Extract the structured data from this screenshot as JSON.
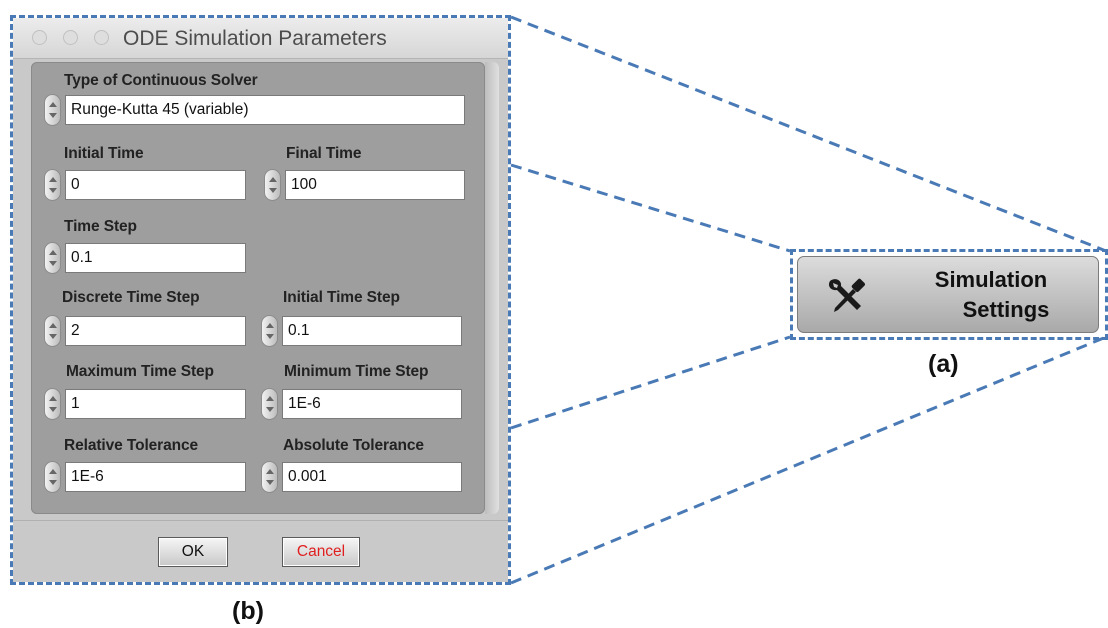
{
  "dialog": {
    "title": "ODE Simulation Parameters",
    "solver": {
      "label": "Type of Continuous Solver",
      "value": "Runge-Kutta 45 (variable)"
    },
    "fields": {
      "initial_time": {
        "label": "Initial Time",
        "value": "0"
      },
      "final_time": {
        "label": "Final Time",
        "value": "100"
      },
      "time_step": {
        "label": "Time Step",
        "value": "0.1"
      },
      "discrete_time_step": {
        "label": "Discrete Time Step",
        "value": "2"
      },
      "initial_time_step": {
        "label": "Initial Time Step",
        "value": "0.1"
      },
      "maximum_time_step": {
        "label": "Maximum Time Step",
        "value": "1"
      },
      "minimum_time_step": {
        "label": "Minimum Time Step",
        "value": "1E-6"
      },
      "relative_tolerance": {
        "label": "Relative Tolerance",
        "value": "1E-6"
      },
      "absolute_tolerance": {
        "label": "Absolute Tolerance",
        "value": "0.001"
      }
    },
    "buttons": {
      "ok": "OK",
      "cancel": "Cancel"
    }
  },
  "simulation_button": {
    "line1": "Simulation",
    "line2": "Settings",
    "icon": "tools-icon"
  },
  "captions": {
    "a": "(a)",
    "b": "(b)"
  },
  "colors": {
    "outline": "#4a7ab5",
    "cancel_text": "#e02020",
    "panel": "#9e9e9e",
    "dialog_bg": "#c9c9c9"
  }
}
